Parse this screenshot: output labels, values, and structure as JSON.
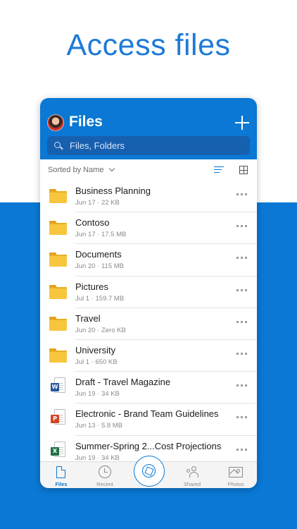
{
  "headline": "Access files",
  "app": {
    "title": "Files",
    "search_placeholder": "Files, Folders",
    "sort_label": "Sorted by Name"
  },
  "icons": {
    "avatar": "avatar",
    "add": "plus-icon",
    "search": "search-icon",
    "list_view": "list-view-icon",
    "grid_view": "grid-view-icon",
    "more": "ellipsis-icon"
  },
  "colors": {
    "accent": "#0a78d4",
    "headline": "#1e7ad8",
    "folder": "#f8c63d",
    "word": "#2b579a",
    "powerpoint": "#d24726",
    "excel": "#217346"
  },
  "files": [
    {
      "name": "Business Planning",
      "meta": "Jun 17 · 22 KB",
      "type": "folder"
    },
    {
      "name": "Contoso",
      "meta": "Jun 17 · 17.5 MB",
      "type": "folder"
    },
    {
      "name": "Documents",
      "meta": "Jun 20 · 115 MB",
      "type": "folder"
    },
    {
      "name": "Pictures",
      "meta": "Jul 1 · 159.7 MB",
      "type": "folder"
    },
    {
      "name": "Travel",
      "meta": "Jun 20 · Zero KB",
      "type": "folder"
    },
    {
      "name": "University",
      "meta": "Jul 1 · 650 KB",
      "type": "folder"
    },
    {
      "name": "Draft - Travel Magazine",
      "meta": "Jun 19 · 34 KB",
      "type": "word",
      "badge": "W"
    },
    {
      "name": "Electronic - Brand Team Guidelines",
      "meta": "Jun 13 · 5.8 MB",
      "type": "powerpoint",
      "badge": "P"
    },
    {
      "name": "Summer-Spring 2...Cost Projections",
      "meta": "Jun 19 · 34 KB",
      "type": "excel",
      "badge": "X"
    }
  ],
  "tabs": [
    {
      "label": "Files",
      "icon": "files-icon",
      "active": true
    },
    {
      "label": "Recent",
      "icon": "clock-icon",
      "active": false
    },
    {
      "label": "Shared",
      "icon": "people-icon",
      "active": false
    },
    {
      "label": "Photos",
      "icon": "photos-icon",
      "active": false
    }
  ],
  "camera_button": {
    "icon": "camera-shutter-icon"
  }
}
